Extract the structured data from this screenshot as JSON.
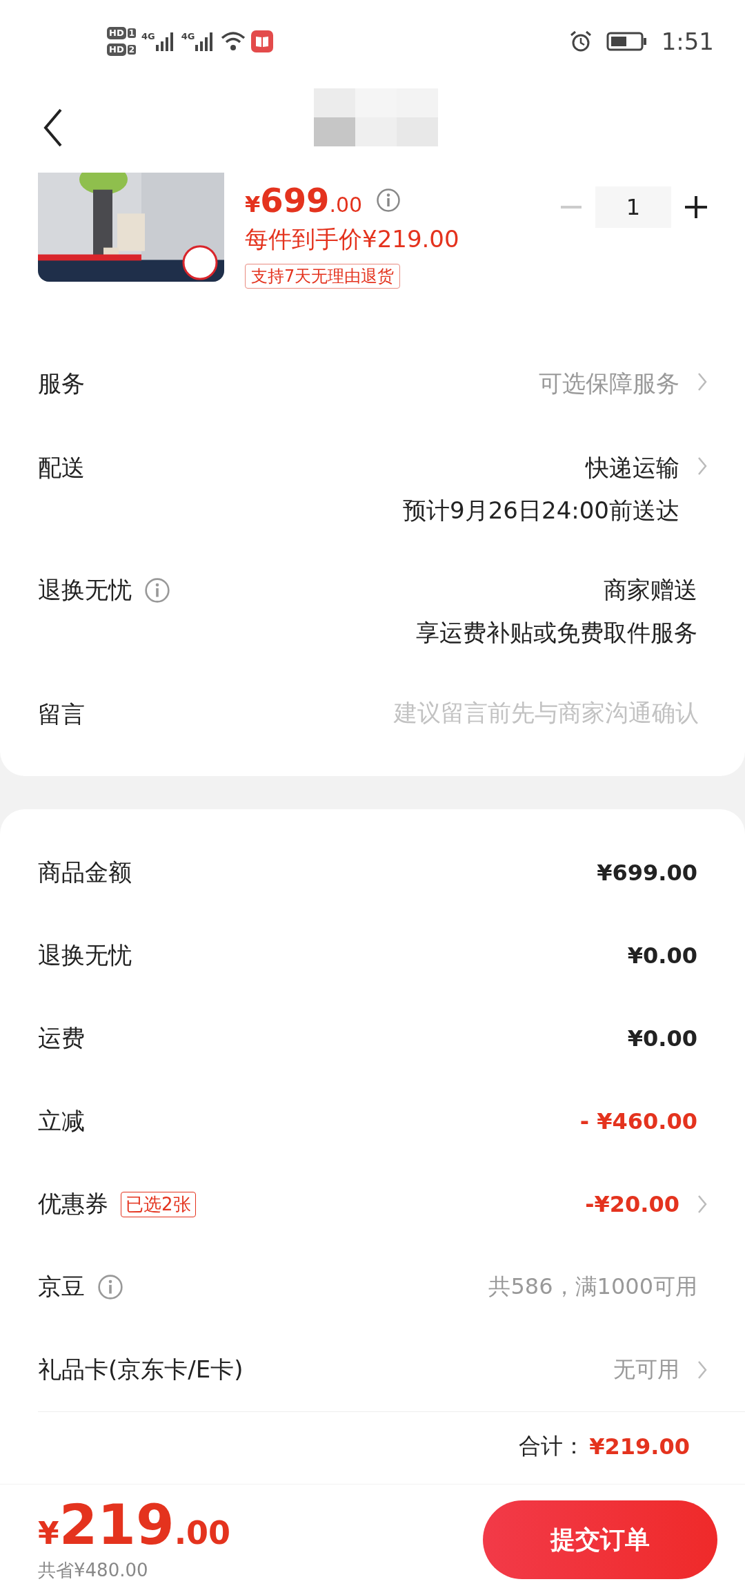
{
  "status_bar": {
    "sim_badges": [
      {
        "label": "HD",
        "slot": "1"
      },
      {
        "label": "HD",
        "slot": "2"
      }
    ],
    "networks": [
      "4G",
      "4G"
    ],
    "time": "1:51"
  },
  "product": {
    "price": {
      "currency": "¥",
      "integer": "699",
      "decimal": ".00"
    },
    "unit_price": "每件到手价¥219.00",
    "return_tag": "支持7天无理由退货",
    "quantity": "1"
  },
  "options": [
    {
      "kind": "link",
      "label": "服务",
      "info": false,
      "lines": [
        "可选保障服务"
      ],
      "muted": true,
      "chevron": true
    },
    {
      "kind": "link",
      "label": "配送",
      "info": false,
      "lines": [
        "快递运输",
        "预计9月26日24:00前送达"
      ],
      "muted": false,
      "chevron": true
    },
    {
      "kind": "text",
      "label": "退换无忧",
      "info": true,
      "lines": [
        "商家赠送",
        "享运费补贴或免费取件服务"
      ],
      "muted": false,
      "chevron": false
    },
    {
      "kind": "input",
      "label": "留言",
      "info": false,
      "placeholder": "建议留言前先与商家沟通确认",
      "chevron": false
    }
  ],
  "summary": [
    {
      "label": "商品金额",
      "value": "¥699.00",
      "kind": "normal",
      "info": false,
      "chevron": false
    },
    {
      "label": "退换无忧",
      "value": "¥0.00",
      "kind": "normal",
      "info": false,
      "chevron": false
    },
    {
      "label": "运费",
      "value": "¥0.00",
      "kind": "normal",
      "info": false,
      "chevron": false
    },
    {
      "label": "立减",
      "value": "- ¥460.00",
      "kind": "discount",
      "info": false,
      "chevron": false
    },
    {
      "label": "优惠券",
      "badge": "已选2张",
      "value": "-¥20.00",
      "kind": "discount",
      "info": false,
      "chevron": true
    },
    {
      "label": "京豆",
      "value": "共586，满1000可用",
      "kind": "muted",
      "info": true,
      "chevron": false
    },
    {
      "label": "礼品卡(京东卡/E卡)",
      "value": "无可用",
      "kind": "muted",
      "info": false,
      "chevron": true
    }
  ],
  "total": {
    "label": "合计：",
    "amount": "¥219.00"
  },
  "footer": {
    "price": {
      "currency": "¥",
      "integer": "219",
      "decimal": ".00"
    },
    "savings": "共省¥480.00",
    "submit": "提交订单"
  }
}
